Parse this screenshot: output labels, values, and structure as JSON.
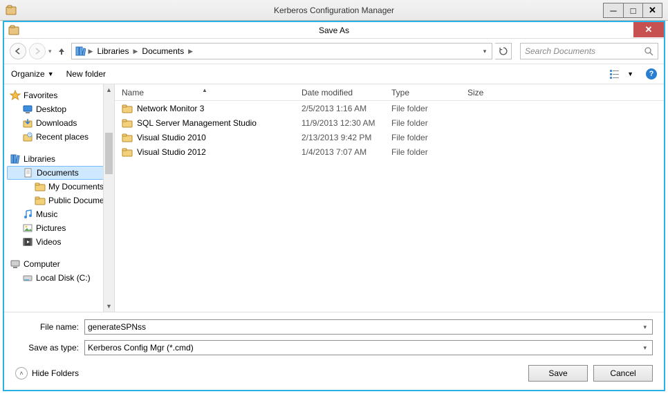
{
  "app": {
    "title": "Kerberos Configuration Manager"
  },
  "dialog": {
    "title": "Save As"
  },
  "breadcrumb": {
    "root": "Libraries",
    "current": "Documents"
  },
  "search": {
    "placeholder": "Search Documents"
  },
  "toolbar": {
    "organize": "Organize",
    "new_folder": "New folder"
  },
  "columns": {
    "name": "Name",
    "date": "Date modified",
    "type": "Type",
    "size": "Size"
  },
  "tree": {
    "favorites": "Favorites",
    "desktop": "Desktop",
    "downloads": "Downloads",
    "recent": "Recent places",
    "libraries": "Libraries",
    "documents": "Documents",
    "my_documents": "My Documents",
    "public_documents": "Public Documents",
    "music": "Music",
    "pictures": "Pictures",
    "videos": "Videos",
    "computer": "Computer",
    "local_disk": "Local Disk (C:)"
  },
  "files": [
    {
      "name": "Network Monitor 3",
      "date": "2/5/2013 1:16 AM",
      "type": "File folder",
      "size": ""
    },
    {
      "name": "SQL Server Management Studio",
      "date": "11/9/2013 12:30 AM",
      "type": "File folder",
      "size": ""
    },
    {
      "name": "Visual Studio 2010",
      "date": "2/13/2013 9:42 PM",
      "type": "File folder",
      "size": ""
    },
    {
      "name": "Visual Studio 2012",
      "date": "1/4/2013 7:07 AM",
      "type": "File folder",
      "size": ""
    }
  ],
  "form": {
    "file_name_label": "File name:",
    "file_name_value": "generateSPNss",
    "save_type_label": "Save as type:",
    "save_type_value": "Kerberos Config Mgr (*.cmd)",
    "hide_folders": "Hide Folders",
    "save": "Save",
    "cancel": "Cancel"
  }
}
